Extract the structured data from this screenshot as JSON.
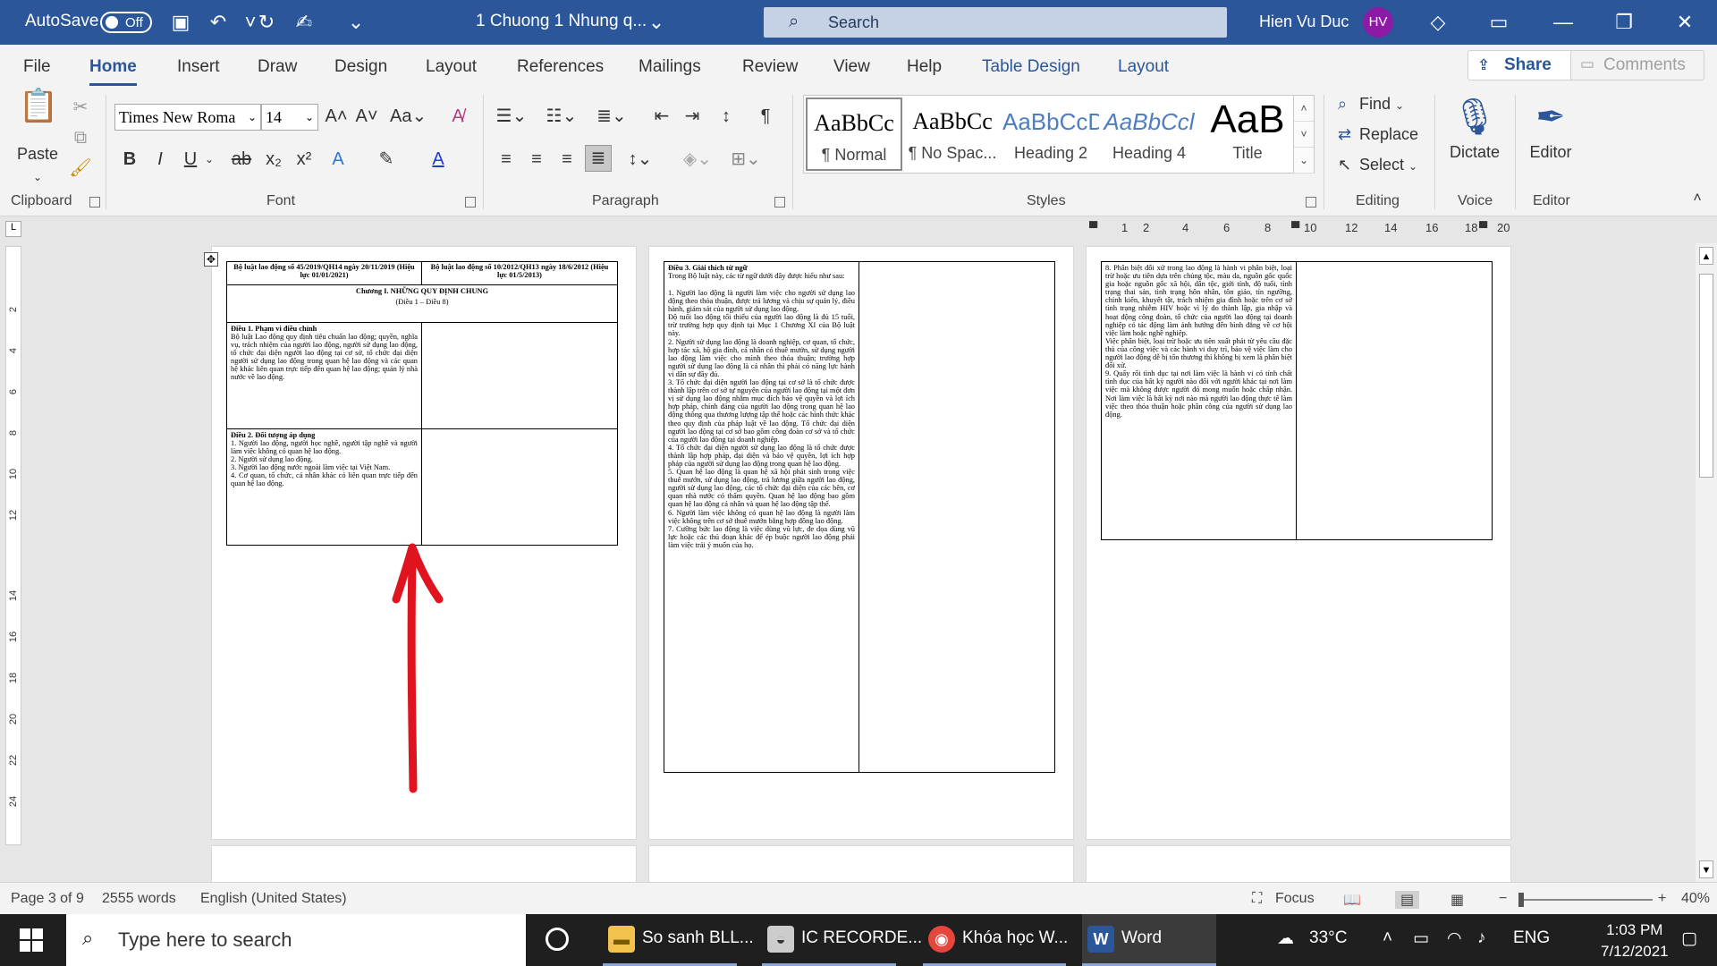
{
  "titlebar": {
    "autosave_label": "AutoSave",
    "autosave_state": "Off",
    "doc_title": "1 Chuong 1 Nhung q...",
    "search_placeholder": "Search",
    "user_name": "Hien Vu Duc",
    "user_initials": "HV"
  },
  "tabs": [
    "File",
    "Home",
    "Insert",
    "Draw",
    "Design",
    "Layout",
    "References",
    "Mailings",
    "Review",
    "View",
    "Help",
    "Table Design",
    "Layout"
  ],
  "share_label": "Share",
  "comments_label": "Comments",
  "ribbon": {
    "clipboard": {
      "paste": "Paste",
      "label": "Clipboard"
    },
    "font": {
      "name": "Times New Roma",
      "size": "14",
      "label": "Font"
    },
    "paragraph": {
      "label": "Paragraph"
    },
    "styles": {
      "label": "Styles",
      "items": [
        {
          "preview": "AaBbCc",
          "name": "¶ Normal"
        },
        {
          "preview": "AaBbCc",
          "name": "¶ No Spac..."
        },
        {
          "preview": "AaBbCcD",
          "name": "Heading 2"
        },
        {
          "preview": "AaBbCcl",
          "name": "Heading 4"
        },
        {
          "preview": "AaB",
          "name": "Title"
        }
      ]
    },
    "editing": {
      "find": "Find",
      "replace": "Replace",
      "select": "Select",
      "label": "Editing"
    },
    "voice": {
      "dictate": "Dictate",
      "label": "Voice"
    },
    "editor": {
      "button": "Editor",
      "label": "Editor"
    }
  },
  "ruler_numbers": [
    "1",
    "2",
    "4",
    "6",
    "8",
    "10",
    "12",
    "14",
    "16",
    "18",
    "20"
  ],
  "vruler_numbers": [
    "2",
    "4",
    "6",
    "8",
    "10",
    "12",
    "14",
    "16",
    "18",
    "20",
    "22",
    "24"
  ],
  "page1": {
    "header_left": "Bộ luật lao động số 45/2019/QH14 ngày 20/11/2019 (Hiệu lực 01/01/2021)",
    "header_right": "Bộ luật lao động số 10/2012/QH13 ngày 18/6/2012 (Hiệu lực 01/5/2013)",
    "chapter_title": "Chương I. NHỮNG QUY ĐỊNH CHUNG",
    "chapter_sub": "(Điều 1 – Điều 8)",
    "art1_title": "Điều 1. Phạm vi điều chỉnh",
    "art1_body": "Bộ luật Lao động quy định tiêu chuẩn lao động; quyền, nghĩa vụ, trách nhiệm của người lao động, người sử dụng lao động, tổ chức đại diện người lao động tại cơ sở, tổ chức đại diện người sử dụng lao động trong quan hệ lao động và các quan hệ khác liên quan trực tiếp đến quan hệ lao động; quản lý nhà nước về lao động.",
    "art2_title": "Điều 2. Đối tượng áp dụng",
    "art2_body": "1. Người lao động, người học nghề, người tập nghề và người làm việc không có quan hệ lao động.\n2. Người sử dụng lao động.\n3. Người lao động nước ngoài làm việc tại Việt Nam.\n4. Cơ quan, tổ chức, cá nhân khác có liên quan trực tiếp đến quan hệ lao động."
  },
  "page2": {
    "art3_title": "Điều 3. Giải thích từ ngữ",
    "art3_intro": "Trong Bộ luật này, các từ ngữ dưới đây được hiểu như sau:",
    "art3_body": "1. Người lao động là người làm việc cho người sử dụng lao động theo thỏa thuận, được trả lương và chịu sự quản lý, điều hành, giám sát của người sử dụng lao động.\nĐộ tuổi lao động tối thiểu của người lao động là đủ 15 tuổi, trừ trường hợp quy định tại Mục 1 Chương XI của Bộ luật này.\n2. Người sử dụng lao động là doanh nghiệp, cơ quan, tổ chức, hợp tác xã, hộ gia đình, cá nhân có thuê mướn, sử dụng người lao động làm việc cho mình theo thỏa thuận; trường hợp người sử dụng lao động là cá nhân thì phải có năng lực hành vi dân sự đầy đủ.\n3. Tổ chức đại diện người lao động tại cơ sở là tổ chức được thành lập trên cơ sở tự nguyện của người lao động tại một đơn vị sử dụng lao động nhằm mục đích bảo vệ quyền và lợi ích hợp pháp, chính đáng của người lao động trong quan hệ lao động thông qua thương lượng tập thể hoặc các hình thức khác theo quy định của pháp luật về lao động. Tổ chức đại diện người lao động tại cơ sở bao gồm công đoàn cơ sở và tổ chức của người lao động tại doanh nghiệp.\n4. Tổ chức đại diện người sử dụng lao động là tổ chức được thành lập hợp pháp, đại diện và bảo vệ quyền, lợi ích hợp pháp của người sử dụng lao động trong quan hệ lao động.\n5. Quan hệ lao động là quan hệ xã hội phát sinh trong việc thuê mướn, sử dụng lao động, trả lương giữa người lao động, người sử dụng lao động, các tổ chức đại diện của các bên, cơ quan nhà nước có thẩm quyền. Quan hệ lao động bao gồm quan hệ lao động cá nhân và quan hệ lao động tập thể.\n6. Người làm việc không có quan hệ lao động là người làm việc không trên cơ sở thuê mướn bằng hợp đồng lao động.\n7. Cưỡng bức lao động là việc dùng vũ lực, đe dọa dùng vũ lực hoặc các thủ đoạn khác để ép buộc người lao động phải làm việc trái ý muốn của họ."
  },
  "page3": {
    "body": "8. Phân biệt đối xử trong lao động là hành vi phân biệt, loại trừ hoặc ưu tiên dựa trên chủng tộc, màu da, nguồn gốc quốc gia hoặc nguồn gốc xã hội, dân tộc, giới tính, độ tuổi, tình trạng thai sản, tình trạng hôn nhân, tôn giáo, tín ngưỡng, chính kiến, khuyết tật, trách nhiệm gia đình hoặc trên cơ sở tình trạng nhiễm HIV hoặc vì lý do thành lập, gia nhập và hoạt động công đoàn, tổ chức của người lao động tại doanh nghiệp có tác động làm ảnh hưởng đến bình đẳng về cơ hội việc làm hoặc nghề nghiệp.\nViệc phân biệt, loại trừ hoặc ưu tiên xuất phát từ yêu cầu đặc thù của công việc và các hành vi duy trì, bảo vệ việc làm cho người lao động dễ bị tổn thương thì không bị xem là phân biệt đối xử.\n9. Quấy rối tình dục tại nơi làm việc là hành vi có tính chất tình dục của bất kỳ người nào đối với người khác tại nơi làm việc mà không được người đó mong muốn hoặc chấp nhận. Nơi làm việc là bất kỳ nơi nào mà người lao động thực tế làm việc theo thỏa thuận hoặc phân công của người sử dụng lao động."
  },
  "status": {
    "page": "Page 3 of 9",
    "words": "2555 words",
    "language": "English (United States)",
    "focus": "Focus",
    "zoom": "40%"
  },
  "taskbar": {
    "search_placeholder": "Type here to search",
    "apps": [
      "So sanh BLL...",
      "IC RECORDE...",
      "Khóa học W...",
      "Word"
    ],
    "temperature": "33°C",
    "lang": "ENG",
    "time": "1:03 PM",
    "date": "7/12/2021"
  },
  "annotation_color": "#e0141e"
}
